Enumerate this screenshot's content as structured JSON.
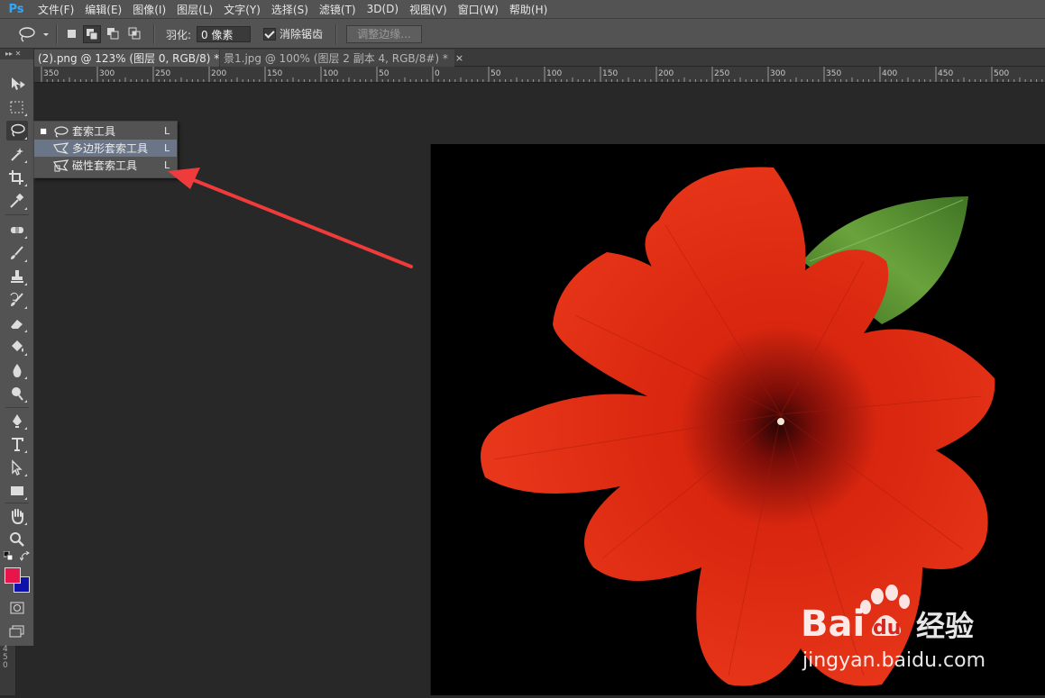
{
  "app": {
    "logo": "Ps"
  },
  "menu": {
    "items": [
      "文件(F)",
      "编辑(E)",
      "图像(I)",
      "图层(L)",
      "文字(Y)",
      "选择(S)",
      "滤镜(T)",
      "3D(D)",
      "视图(V)",
      "窗口(W)",
      "帮助(H)"
    ]
  },
  "options": {
    "feather_label": "羽化:",
    "feather_value": "0 像素",
    "antialias_label": "消除锯齿",
    "antialias_checked": true,
    "refine_edge_label": "调整边缘..."
  },
  "tabs": [
    {
      "label": "(2).png @ 123% (图层 0, RGB/8) *",
      "close": "×",
      "active": true
    },
    {
      "label": "景1.jpg @ 100% (图层 2 副本 4, RGB/8#) *",
      "close": "×",
      "active": false
    }
  ],
  "ruler": {
    "h_labels": [
      "350",
      "300",
      "250",
      "200",
      "150",
      "100",
      "50",
      "0",
      "50",
      "100",
      "150",
      "200",
      "250",
      "300",
      "350",
      "400",
      "450",
      "500"
    ],
    "v_labels": [
      "4",
      "5",
      "0"
    ]
  },
  "toolbar": {
    "grip": "▸▸ ✕",
    "active_tool": "lasso",
    "foreground_color": "#e8154c",
    "background_color": "#0f12a8"
  },
  "flyout": {
    "items": [
      {
        "label": "套索工具",
        "shortcut": "L",
        "selected": true,
        "hover": false
      },
      {
        "label": "多边形套索工具",
        "shortcut": "L",
        "selected": false,
        "hover": true
      },
      {
        "label": "磁性套索工具",
        "shortcut": "L",
        "selected": false,
        "hover": false
      }
    ]
  },
  "watermark": {
    "brand": "Bai",
    "brand_tail": "经验",
    "url": "jingyan.baidu.com"
  },
  "colors": {
    "annotation_arrow": "#ef3b3b",
    "petal": "#e02a14",
    "leaf": "#4f8a2a"
  }
}
